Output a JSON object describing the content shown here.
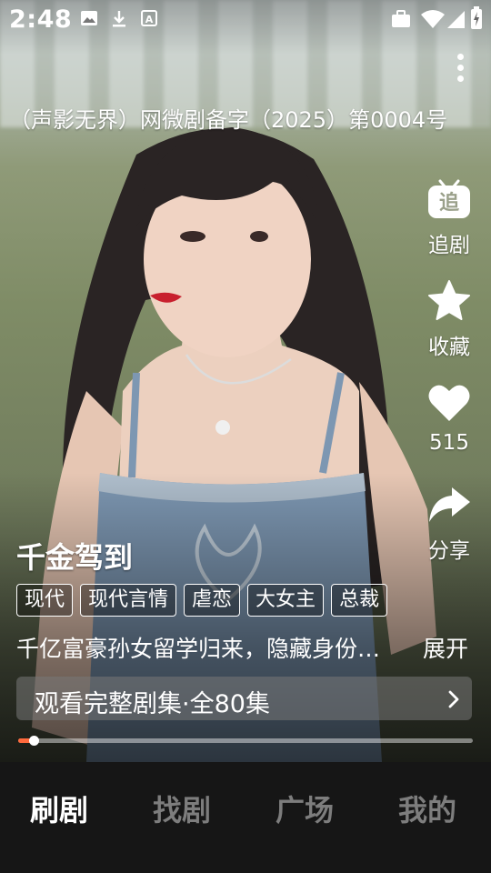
{
  "status_bar": {
    "time": "2:48"
  },
  "video": {
    "title": "（声影无界）网微剧备字（2025）第0004号",
    "drama_name": "千金驾到",
    "tags": [
      "现代",
      "现代言情",
      "虐恋",
      "大女主",
      "总裁"
    ],
    "description": "千亿富豪孙女留学归来，隐藏身份…",
    "expand_label": "展开",
    "watch_full_label": "观看完整剧集·全80集",
    "progress_fraction": 0.02
  },
  "side_actions": {
    "follow_label": "追剧",
    "follow_icon_glyph": "追",
    "collect_label": "收藏",
    "like_count": "515",
    "share_label": "分享"
  },
  "tabs": [
    {
      "label": "刷剧",
      "active": true
    },
    {
      "label": "找剧",
      "active": false
    },
    {
      "label": "广场",
      "active": false
    },
    {
      "label": "我的",
      "active": false
    }
  ],
  "colors": {
    "progress_accent": "#ff6a3d",
    "tab_active": "#ffffff",
    "tab_inactive": "#7d7d7d",
    "tabbar_bg": "#161616"
  }
}
